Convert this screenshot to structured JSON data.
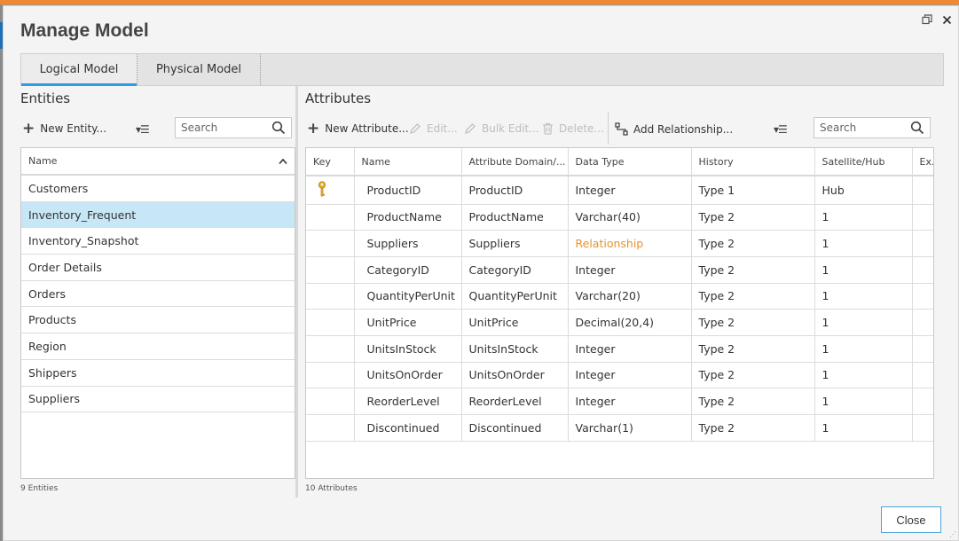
{
  "dialog": {
    "title": "Manage Model"
  },
  "window": {
    "restore_icon": "restore-icon",
    "close_icon": "close-icon"
  },
  "tabs": [
    {
      "label": "Logical Model",
      "active": true
    },
    {
      "label": "Physical Model",
      "active": false
    }
  ],
  "entities": {
    "title": "Entities",
    "new_label": "New Entity...",
    "search_placeholder": "Search",
    "column_header": "Name",
    "items": [
      "Customers",
      "Inventory_Frequent",
      "Inventory_Snapshot",
      "Order Details",
      "Orders",
      "Products",
      "Region",
      "Shippers",
      "Suppliers"
    ],
    "selected_index": 1,
    "count_label": "9 Entities"
  },
  "attributes": {
    "title": "Attributes",
    "toolbar": {
      "new_label": "New Attribute...",
      "edit_label": "Edit...",
      "bulk_edit_label": "Bulk Edit...",
      "delete_label": "Delete...",
      "add_relationship_label": "Add Relationship..."
    },
    "search_placeholder": "Search",
    "columns": [
      "Key",
      "Name",
      "Attribute Domain/...",
      "Data Type",
      "History",
      "Satellite/Hub",
      "Ex..."
    ],
    "rows": [
      {
        "key": true,
        "name": "ProductID",
        "domain": "ProductID",
        "type": "Integer",
        "history": "Type 1",
        "sat": "Hub"
      },
      {
        "key": false,
        "name": "ProductName",
        "domain": "ProductName",
        "type": "Varchar(40)",
        "history": "Type 2",
        "sat": "1"
      },
      {
        "key": false,
        "name": "Suppliers",
        "domain": "Suppliers",
        "type": "Relationship",
        "history": "Type 2",
        "sat": "1"
      },
      {
        "key": false,
        "name": "CategoryID",
        "domain": "CategoryID",
        "type": "Integer",
        "history": "Type 2",
        "sat": "1"
      },
      {
        "key": false,
        "name": "QuantityPerUnit",
        "domain": "QuantityPerUnit",
        "type": "Varchar(20)",
        "history": "Type 2",
        "sat": "1"
      },
      {
        "key": false,
        "name": "UnitPrice",
        "domain": "UnitPrice",
        "type": "Decimal(20,4)",
        "history": "Type 2",
        "sat": "1"
      },
      {
        "key": false,
        "name": "UnitsInStock",
        "domain": "UnitsInStock",
        "type": "Integer",
        "history": "Type 2",
        "sat": "1"
      },
      {
        "key": false,
        "name": "UnitsOnOrder",
        "domain": "UnitsOnOrder",
        "type": "Integer",
        "history": "Type 2",
        "sat": "1"
      },
      {
        "key": false,
        "name": "ReorderLevel",
        "domain": "ReorderLevel",
        "type": "Integer",
        "history": "Type 2",
        "sat": "1"
      },
      {
        "key": false,
        "name": "Discontinued",
        "domain": "Discontinued",
        "type": "Varchar(1)",
        "history": "Type 2",
        "sat": "1"
      }
    ],
    "count_label": "10 Attributes"
  },
  "footer": {
    "close_label": "Close"
  },
  "colors": {
    "accent": "#2c9be0",
    "top_bar": "#f08a30",
    "selected_row": "#c7e7f6",
    "relationship": "#e8922e"
  }
}
